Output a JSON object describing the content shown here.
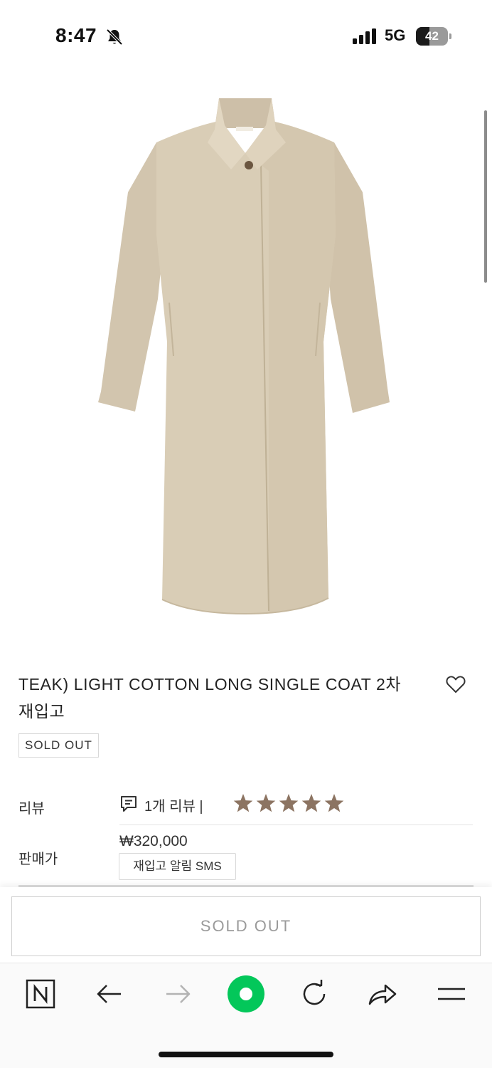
{
  "status_bar": {
    "time": "8:47",
    "network": "5G",
    "battery": "42"
  },
  "product": {
    "title": "TEAK) LIGHT COTTON LONG SINGLE COAT 2차 재입고",
    "badge": "SOLD OUT",
    "image_icon": "beige-long-coat-photo",
    "wishlist_icon": "heart-outline-icon"
  },
  "info": {
    "review_label": "리뷰",
    "review_count": "1개 리뷰 |",
    "rating": 5,
    "rating_max": 5,
    "star_color": "#8c7462",
    "price_label": "판매가",
    "price": "₩320,000",
    "sms_button": "재입고 알림 SMS"
  },
  "purchase": {
    "soldout_button": "SOLD OUT"
  },
  "toolbar": {
    "items": [
      "naver-home-icon",
      "back-arrow-icon",
      "forward-arrow-icon",
      "green-dot-icon",
      "reload-icon",
      "share-icon",
      "menu-icon"
    ],
    "accent": "#03c75a"
  }
}
